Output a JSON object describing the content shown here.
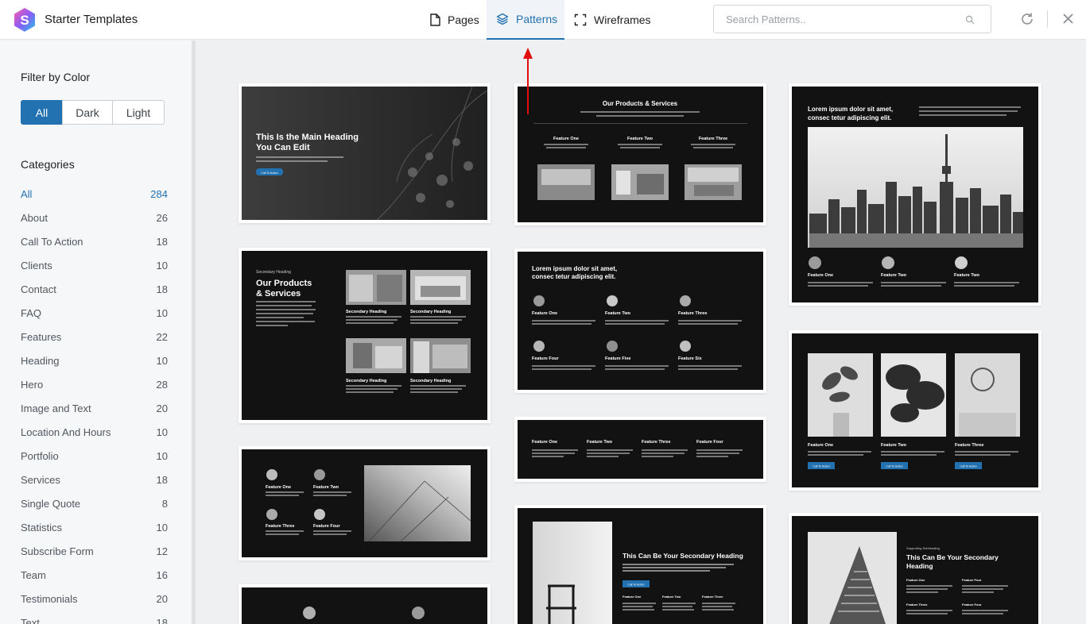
{
  "header": {
    "app_title": "Starter Templates",
    "tabs": [
      {
        "label": "Pages",
        "icon": "page-icon"
      },
      {
        "label": "Patterns",
        "icon": "layers-icon",
        "active": true
      },
      {
        "label": "Wireframes",
        "icon": "frame-icon"
      }
    ],
    "search_placeholder": "Search Patterns..",
    "accent_color": "#2271b1"
  },
  "sidebar": {
    "filter_title": "Filter by Color",
    "color_filters": [
      "All",
      "Dark",
      "Light"
    ],
    "active_color_filter": "All",
    "categories_title": "Categories",
    "categories": [
      {
        "label": "All",
        "count": "284",
        "active": true
      },
      {
        "label": "About",
        "count": "26"
      },
      {
        "label": "Call To Action",
        "count": "18"
      },
      {
        "label": "Clients",
        "count": "10"
      },
      {
        "label": "Contact",
        "count": "18"
      },
      {
        "label": "FAQ",
        "count": "10"
      },
      {
        "label": "Features",
        "count": "22"
      },
      {
        "label": "Heading",
        "count": "10"
      },
      {
        "label": "Hero",
        "count": "28"
      },
      {
        "label": "Image and Text",
        "count": "20"
      },
      {
        "label": "Location And Hours",
        "count": "10"
      },
      {
        "label": "Portfolio",
        "count": "10"
      },
      {
        "label": "Services",
        "count": "18"
      },
      {
        "label": "Single Quote",
        "count": "8"
      },
      {
        "label": "Statistics",
        "count": "10"
      },
      {
        "label": "Subscribe Form",
        "count": "12"
      },
      {
        "label": "Team",
        "count": "16"
      },
      {
        "label": "Testimonials",
        "count": "20"
      },
      {
        "label": "Text",
        "count": "18"
      }
    ]
  },
  "patterns": {
    "hero": {
      "heading_1": "This Is the Main Heading",
      "heading_2": "You Can Edit",
      "button": "Call To Action"
    },
    "products_header": {
      "title": "Our Products & Services",
      "features": [
        "Feature One",
        "Feature Two",
        "Feature Three"
      ]
    },
    "city": {
      "heading_1": "Lorem ipsum dolor sit amet,",
      "heading_2": "consec tetur adipiscing elit.",
      "features": [
        "Feature One",
        "Feature Two",
        "Feature Two"
      ]
    },
    "products_grid": {
      "eyebrow": "Secondary Heading",
      "title_1": "Our Products",
      "title_2": "& Services",
      "items": [
        "Secondary Heading",
        "Secondary Heading",
        "Secondary Heading",
        "Secondary Heading"
      ]
    },
    "six_features": {
      "heading_1": "Lorem ipsum dolor sit amet,",
      "heading_2": "consec tetur adipiscing elit.",
      "features": [
        "Feature One",
        "Feature Two",
        "Feature Three",
        "Feature Four",
        "Feature Five",
        "Feature Six"
      ]
    },
    "four_columns": {
      "features": [
        "Feature One",
        "Feature Two",
        "Feature Three",
        "Feature Four"
      ]
    },
    "plants": {
      "features": [
        "Feature One",
        "Feature Two",
        "Feature Three"
      ],
      "button": "Call To Action"
    },
    "four_features_image": {
      "features": [
        "Feature One",
        "Feature Two",
        "Feature Three",
        "Feature Four"
      ]
    },
    "chair": {
      "heading": "This Can Be Your Secondary Heading",
      "button": "Call To Action",
      "features": [
        "Feature One",
        "Feature Two",
        "Feature Three"
      ]
    },
    "building": {
      "eyebrow": "Supporting Subheading",
      "heading_1": "This Can Be Your Secondary",
      "heading_2": "Heading",
      "features": [
        "Feature One",
        "Feature Four",
        "Feature Three",
        "Feature Four"
      ]
    }
  }
}
